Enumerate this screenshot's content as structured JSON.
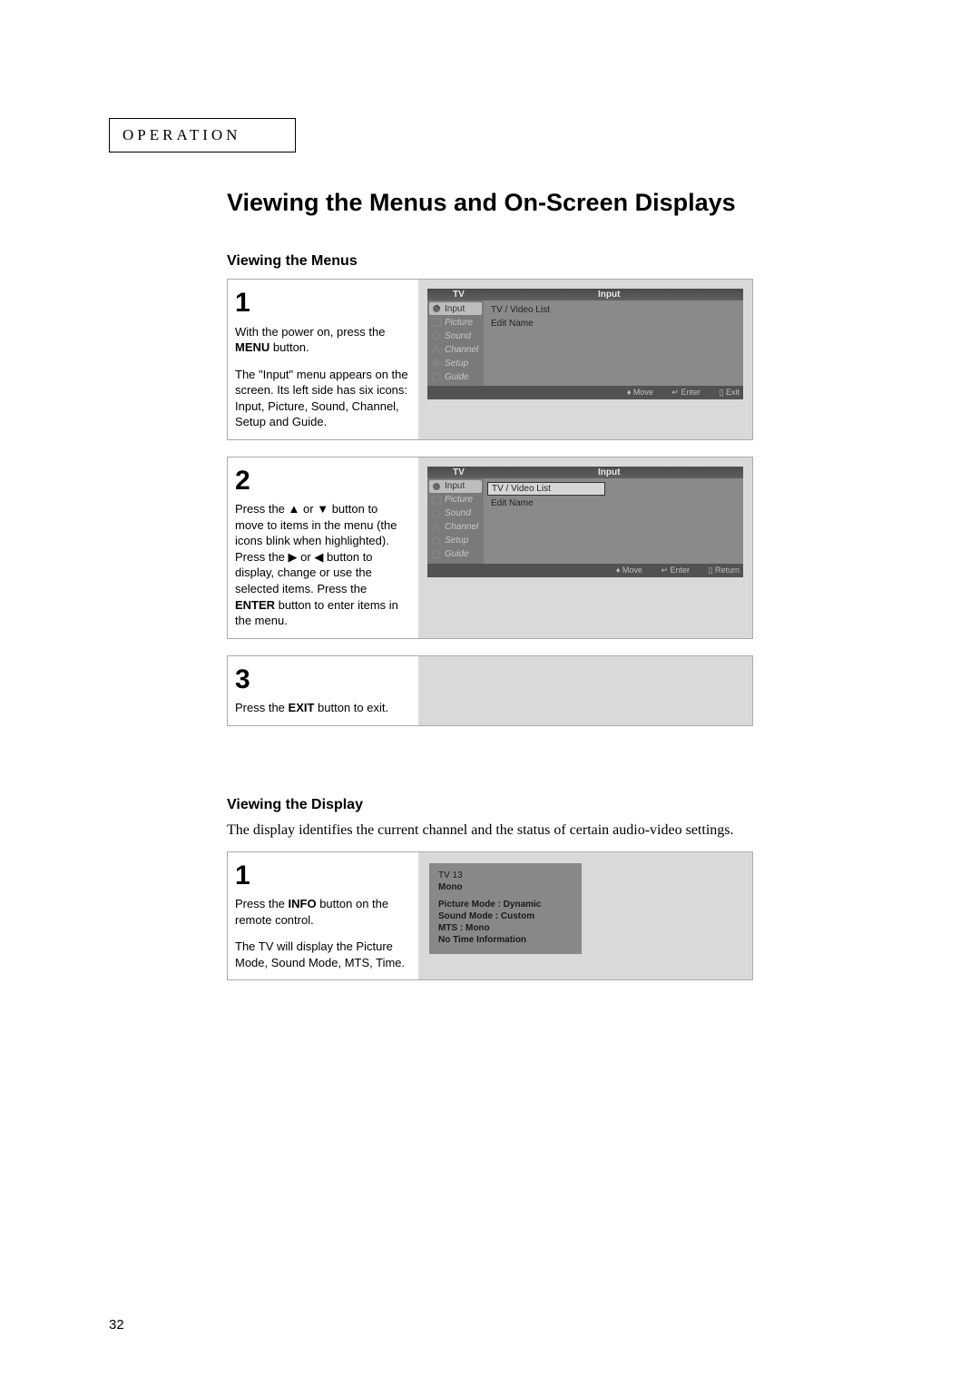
{
  "section_header": "OPERATION",
  "main_title": "Viewing the Menus and On-Screen Displays",
  "section_a": {
    "title": "Viewing the Menus",
    "step1": {
      "num": "1",
      "p1_a": "With the power on, press the ",
      "p1_b": "MENU",
      "p1_c": " button.",
      "p2": "The \"Input\" menu appears on the screen. Its left side has six icons: Input, Picture, Sound, Channel, Setup and Guide."
    },
    "step2": {
      "num": "2",
      "p1_a": "Press the ",
      "arr_up": "▲",
      "p1_b": " or ",
      "arr_dn": "▼",
      "p1_c": " button to move to items in the menu (the icons blink when highlighted).",
      "p2_a": "Press the ",
      "arr_r": "▶",
      "p2_b": " or ",
      "arr_l": "◀",
      "p2_c": " button to display, change or use the selected items. Press the ",
      "p2_d": "ENTER",
      "p2_e": " button to enter items in the menu."
    },
    "step3": {
      "num": "3",
      "p_a": "Press the ",
      "p_b": "EXIT",
      "p_c": " button to exit."
    }
  },
  "section_b": {
    "title": "Viewing the Display",
    "intro": "The display identifies the current channel and the status of certain audio-video settings.",
    "step1": {
      "num": "1",
      "p1_a": "Press the ",
      "p1_b": "INFO",
      "p1_c": " button on the remote control.",
      "p2": "The TV will display the Picture Mode, Sound Mode, MTS, Time."
    }
  },
  "osd": {
    "hl": "TV",
    "hc": "Input",
    "items": [
      "Input",
      "Picture",
      "Sound",
      "Channel",
      "Setup",
      "Guide"
    ],
    "opts": [
      "TV / Video List",
      "Edit Name"
    ],
    "footer": {
      "move": "Move",
      "enter": "Enter",
      "exit": "Exit",
      "ret": "Return"
    }
  },
  "info": {
    "l1": "TV 13",
    "l2": "Mono",
    "l3": "Picture Mode : Dynamic",
    "l4": "Sound Mode : Custom",
    "l5": "MTS : Mono",
    "l6": "No Time Information"
  },
  "page_number": "32"
}
